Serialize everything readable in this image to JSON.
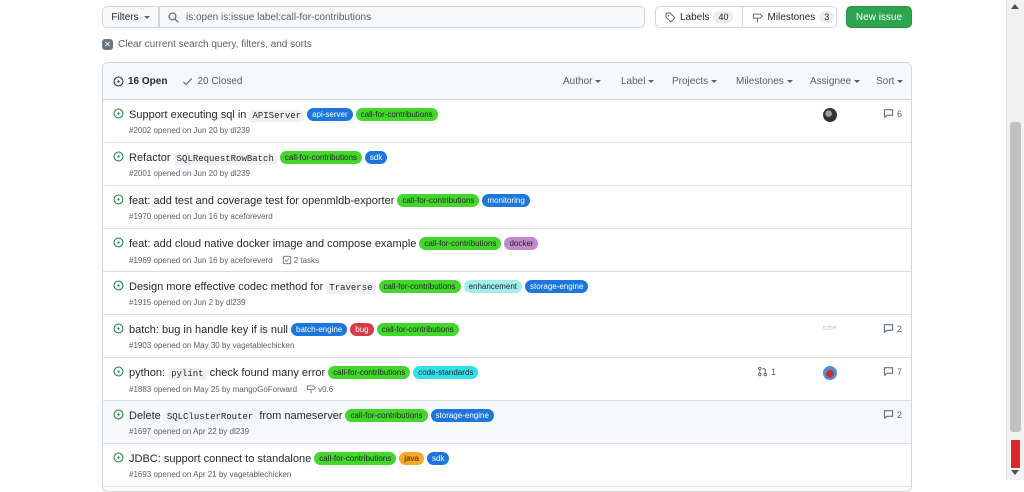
{
  "toolbar": {
    "filters_label": "Filters",
    "search_value": "is:open is:issue label:call-for-contributions",
    "labels_label": "Labels",
    "labels_count": "40",
    "milestones_label": "Milestones",
    "milestones_count": "3",
    "new_issue_label": "New issue"
  },
  "clear_text": "Clear current search query, filters, and sorts",
  "header": {
    "open_label": "16 Open",
    "closed_label": "20 Closed",
    "filters": [
      "Author",
      "Label",
      "Projects",
      "Milestones",
      "Assignee",
      "Sort"
    ]
  },
  "issues": [
    {
      "title": [
        {
          "t": "Support executing sql in "
        },
        {
          "c": "APIServer"
        }
      ],
      "labels": [
        {
          "name": "api-server",
          "bg": "#1d76db",
          "fg": "#ffffff"
        },
        {
          "name": "call-for-contributions",
          "bg": "#44d62c",
          "fg": "#1f2328"
        }
      ],
      "meta": "#2002 opened on Jun 20 by dl239",
      "avatar": "a1",
      "comments": "6"
    },
    {
      "title": [
        {
          "t": "Refactor "
        },
        {
          "c": "SQLRequestRowBatch"
        }
      ],
      "labels": [
        {
          "name": "call-for-contributions",
          "bg": "#44d62c",
          "fg": "#1f2328"
        },
        {
          "name": "sdk",
          "bg": "#1d76db",
          "fg": "#ffffff"
        }
      ],
      "meta": "#2001 opened on Jun 20 by dl239"
    },
    {
      "title": [
        {
          "t": "feat: add test and coverage test for openmldb-exporter"
        }
      ],
      "labels": [
        {
          "name": "call-for-contributions",
          "bg": "#44d62c",
          "fg": "#1f2328"
        },
        {
          "name": "monitoring",
          "bg": "#1d76db",
          "fg": "#ffffff"
        }
      ],
      "meta": "#1970 opened on Jun 16 by aceforeverd"
    },
    {
      "title": [
        {
          "t": "feat: add cloud native docker image and compose example"
        }
      ],
      "labels": [
        {
          "name": "call-for-contributions",
          "bg": "#44d62c",
          "fg": "#1f2328"
        },
        {
          "name": "docker",
          "bg": "#c38ac9",
          "fg": "#1f2328"
        }
      ],
      "meta": "#1969 opened on Jun 16 by aceforeverd",
      "tasks": "2 tasks"
    },
    {
      "title": [
        {
          "t": "Design more effective codec method for "
        },
        {
          "c": "Traverse"
        }
      ],
      "labels": [
        {
          "name": "call-for-contributions",
          "bg": "#44d62c",
          "fg": "#1f2328"
        },
        {
          "name": "enhancement",
          "bg": "#a2eeef",
          "fg": "#1f2328"
        },
        {
          "name": "storage-engine",
          "bg": "#1d76db",
          "fg": "#ffffff"
        }
      ],
      "meta": "#1915 opened on Jun 2 by dl239"
    },
    {
      "title": [
        {
          "t": "batch: bug in handle key if is null"
        }
      ],
      "labels": [
        {
          "name": "batch-engine",
          "bg": "#1d76db",
          "fg": "#ffffff"
        },
        {
          "name": "bug",
          "bg": "#d73a4a",
          "fg": "#ffffff"
        },
        {
          "name": "call-for-contributions",
          "bg": "#44d62c",
          "fg": "#1f2328"
        }
      ],
      "meta": "#1903 opened on May 30 by vagetablechicken",
      "ghost": "tobe",
      "comments": "2"
    },
    {
      "title": [
        {
          "t": "python: "
        },
        {
          "c": "pylint"
        },
        {
          "t": " check found many error"
        }
      ],
      "labels": [
        {
          "name": "call-for-contributions",
          "bg": "#44d62c",
          "fg": "#1f2328"
        },
        {
          "name": "code-standards",
          "bg": "#32e0ea",
          "fg": "#1f2328"
        }
      ],
      "meta": "#1883 opened on May 25 by mangoGoForward",
      "milestone": "v0.6",
      "pr": "1",
      "avatar": "a2",
      "comments": "7"
    },
    {
      "title": [
        {
          "t": "Delete "
        },
        {
          "c": "SQLClusterRouter"
        },
        {
          "t": " from nameserver"
        }
      ],
      "labels": [
        {
          "name": "call-for-contributions",
          "bg": "#44d62c",
          "fg": "#1f2328"
        },
        {
          "name": "storage-engine",
          "bg": "#1d76db",
          "fg": "#ffffff"
        }
      ],
      "meta": "#1697 opened on Apr 22 by dl239",
      "comments": "2",
      "hl": true
    },
    {
      "title": [
        {
          "t": "JDBC: support connect to standalone"
        }
      ],
      "labels": [
        {
          "name": "call-for-contributions",
          "bg": "#44d62c",
          "fg": "#1f2328"
        },
        {
          "name": "java",
          "bg": "#f9a825",
          "fg": "#1f2328"
        },
        {
          "name": "sdk",
          "bg": "#1d76db",
          "fg": "#ffffff"
        }
      ],
      "meta": "#1693 opened on Apr 21 by vagetablechicken"
    }
  ]
}
